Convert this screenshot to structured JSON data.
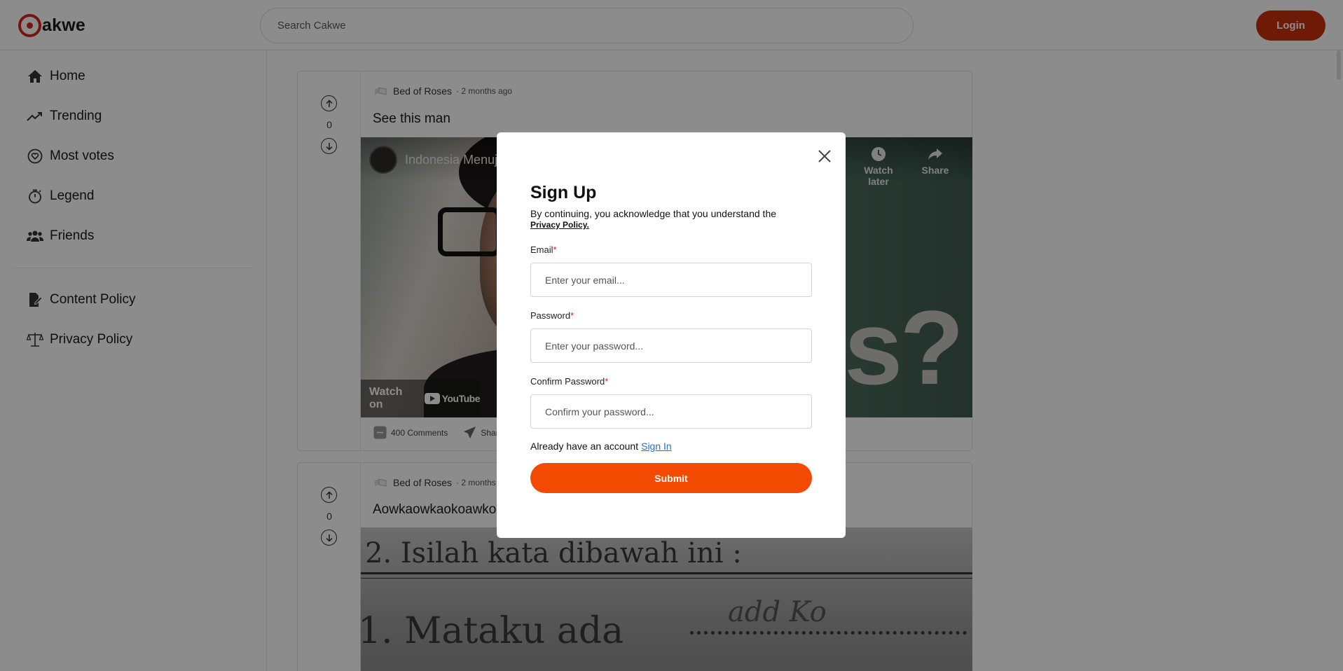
{
  "app": {
    "logo_text": "akwe",
    "search_placeholder": "Search Cakwe",
    "login_label": "Login"
  },
  "sidebar": {
    "items": [
      {
        "label": "Home",
        "icon": "home-icon"
      },
      {
        "label": "Trending",
        "icon": "trending-icon"
      },
      {
        "label": "Most votes",
        "icon": "heart-badge-icon"
      },
      {
        "label": "Legend",
        "icon": "stopwatch-icon"
      },
      {
        "label": "Friends",
        "icon": "users-icon"
      },
      {
        "label": "Content Policy",
        "icon": "document-pen-icon"
      },
      {
        "label": "Privacy Policy",
        "icon": "scales-icon"
      }
    ]
  },
  "posts": [
    {
      "author": "Bed of Roses",
      "time": "· 2 months ago",
      "title": "See this man",
      "votes": "0",
      "video": {
        "title": "Indonesia Menuj",
        "watch_later": "Watch later",
        "share": "Share",
        "watch_on": "Watch on",
        "youtube": "YouTube",
        "overlay_text": "s?"
      },
      "comments": "400 Comments",
      "share_label": "Share"
    },
    {
      "author": "Bed of Roses",
      "time": "· 2 months ago",
      "title": "Aowkaowkaokoawko",
      "votes": "0",
      "image_text": {
        "line1": "2.  Isilah kata dibawah ini :",
        "line2": "1. Mataku ada",
        "line2_fill": "add  Ko"
      }
    }
  ],
  "modal": {
    "title": "Sign Up",
    "description": "By continuing, you acknowledge that you understand the",
    "privacy_link": "Privacy Policy.",
    "email_label": "Email",
    "email_placeholder": "Enter your email...",
    "password_label": "Password",
    "password_placeholder": "Enter your password...",
    "confirm_label": "Confirm Password",
    "confirm_placeholder": "Confirm your password...",
    "required_mark": "*",
    "account_text": "Already have an account",
    "sign_in": "Sign In",
    "submit_label": "Submit"
  },
  "colors": {
    "brand": "#d7261e",
    "login_button": "#c8300b",
    "submit_button": "#f24a00",
    "link": "#1b6fd6",
    "required": "#d0281f"
  }
}
